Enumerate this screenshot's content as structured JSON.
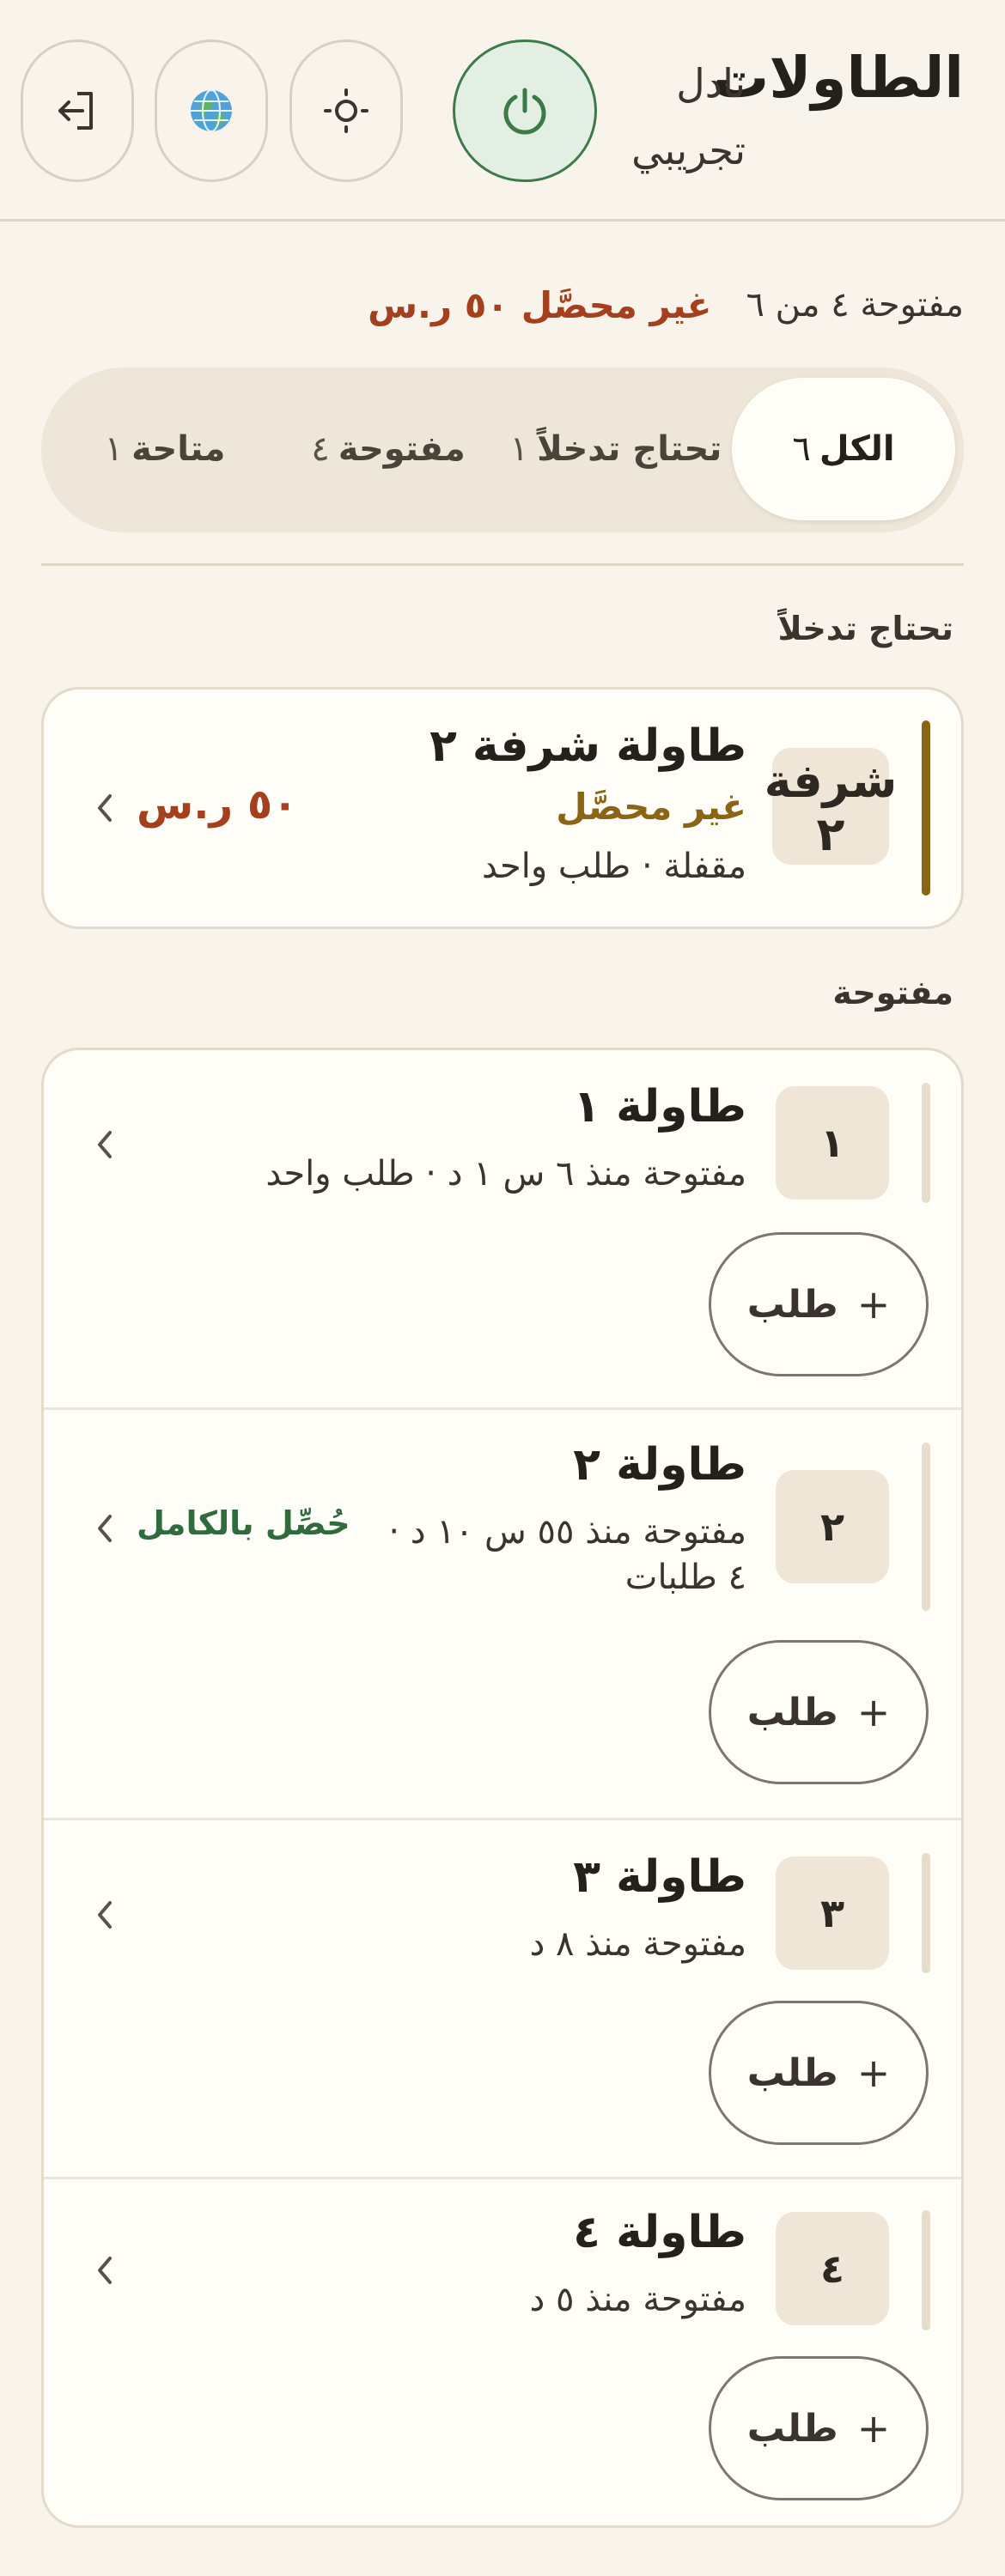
{
  "header": {
    "title": "الطاولات",
    "venue_name": "نادل",
    "venue_subtitle": "تجريبي",
    "icons": [
      "power-icon",
      "settings-sun-icon",
      "globe-icon",
      "logout-icon"
    ],
    "power_color": "#3d7a4a"
  },
  "summary": {
    "open_count": "مفتوحة ٤ من ٦",
    "unpaid": "غير محصَّل ٥٠ ر.س"
  },
  "tabs": [
    {
      "label": "الكل",
      "count": "٦",
      "active": true
    },
    {
      "label": "تحتاج تدخلاً",
      "count": "١",
      "active": false
    },
    {
      "label": "مفتوحة",
      "count": "٤",
      "active": false
    },
    {
      "label": "متاحة",
      "count": "١",
      "active": false
    }
  ],
  "sections": {
    "needs_attention": {
      "title": "تحتاج تدخلاً",
      "tables": [
        {
          "badge": "شرفة ٢",
          "name": "طاولة شرفة ٢",
          "status": "غير محصَّل",
          "meta": "مقفلة · طلب واحد",
          "amount": "٥٠ ر.س"
        }
      ]
    },
    "open": {
      "title": "مفتوحة",
      "order_button_label": "طلب",
      "order_button_plus": "+",
      "tables": [
        {
          "badge": "١",
          "name": "طاولة ١",
          "meta": "مفتوحة منذ ٦ س ١ د · طلب واحد"
        },
        {
          "badge": "٢",
          "name": "طاولة ٢",
          "meta_line1": "مفتوحة منذ ٥٥ س ١٠ د ·",
          "meta_line2": "٤ طلبات",
          "action": "حُصِّل بالكامل"
        },
        {
          "badge": "٣",
          "name": "طاولة ٣",
          "meta": "مفتوحة منذ ٨ د"
        },
        {
          "badge": "٤",
          "name": "طاولة ٤",
          "meta": "مفتوحة منذ ٥ د"
        }
      ]
    }
  },
  "colors": {
    "background": "#f8f4ec",
    "unpaid_red": "#a4401d",
    "status_gold": "#8a6516",
    "collect_green": "#2f6b3c"
  }
}
